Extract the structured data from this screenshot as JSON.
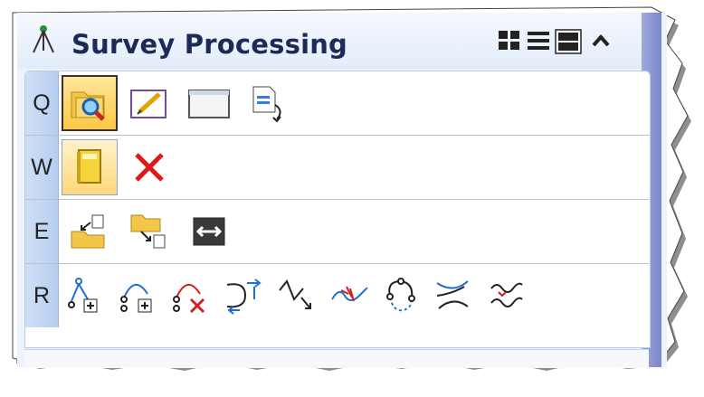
{
  "panel": {
    "title": "Survey Processing",
    "title_icon": "tripod-icon",
    "controls": [
      "grid-view-icon",
      "list-view-icon",
      "large-view-icon",
      "collapse-up-icon"
    ]
  },
  "rows": [
    {
      "key": "Q",
      "icons": [
        "find-folder-icon",
        "edit-icon",
        "blank-window-icon",
        "document-refresh-icon"
      ]
    },
    {
      "key": "W",
      "icons": [
        "field-book-icon",
        "delete-x-icon"
      ]
    },
    {
      "key": "E",
      "icons": [
        "import-folder-icon",
        "export-folder-icon",
        "convert-arrows-icon"
      ]
    },
    {
      "key": "R",
      "icons": [
        "add-node-icon",
        "add-arc-node-icon",
        "delete-node-icon",
        "reverse-direction-icon",
        "break-line-icon",
        "trim-line-icon",
        "close-figure-icon",
        "intersect-icon",
        "join-lines-icon"
      ]
    }
  ],
  "colors": {
    "accent": "#1d2a57",
    "header": "#e2ecf9",
    "key_bg": "#cfe0f7",
    "selected": "#ffc845"
  }
}
